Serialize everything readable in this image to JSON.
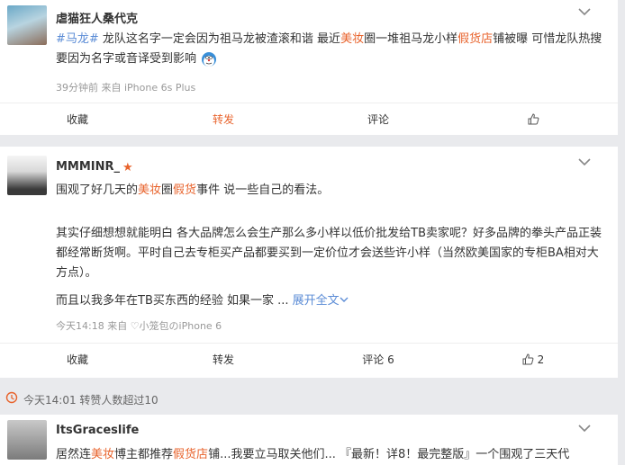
{
  "post1": {
    "username": "虐猫狂人桑代克",
    "tag": "#马龙#",
    "text_a": " 龙队这名字一定会因为祖马龙被渣滚和谐 最近",
    "hl1": "美妆",
    "text_b": "圈一堆祖马龙小样",
    "hl2": "假货店",
    "text_c": "铺被曝 可惜龙队热搜要因为名字或音译受到影响",
    "meta": "39分钟前 来自 iPhone 6s Plus",
    "actions": {
      "collect": "收藏",
      "repost": "转发",
      "comment": "评论",
      "like": ""
    }
  },
  "post2": {
    "username": "MMMINR_",
    "line1_a": "围观了好几天的",
    "line1_hl1": "美妆",
    "line1_b": "圈",
    "line1_hl2": "假货",
    "line1_c": "事件 说一些自己的看法。",
    "para2": "其实仔细想想就能明白 各大品牌怎么会生产那么多小样以低价批发给TB卖家呢？好多品牌的拳头产品正装都经常断货啊。平时自己去专柜买产品都要买到一定价位才会送些许小样（当然欧美国家的专柜BA相对大方点）。",
    "para3": "而且以我多年在TB买东西的经验 如果一家 ...",
    "expand": "展开全文",
    "meta": "今天14:18 来自 ♡小笼包のiPhone 6",
    "actions": {
      "collect": "收藏",
      "repost": "转发",
      "comment": "评论 6",
      "like": "2"
    }
  },
  "notice": {
    "text": "今天14:01  转赞人数超过10"
  },
  "post3": {
    "username": "ItsGraceslife",
    "text_a": "居然连",
    "hl1": "美妆",
    "text_b": "博主都推荐",
    "hl2": "假货店",
    "text_c": "铺...我要立马取关他们... 『最新！详8！最完整版』一个围观了三天代"
  },
  "colors": {
    "accent": "#e8632c",
    "link": "#5b8cd6",
    "meta": "#999999"
  }
}
